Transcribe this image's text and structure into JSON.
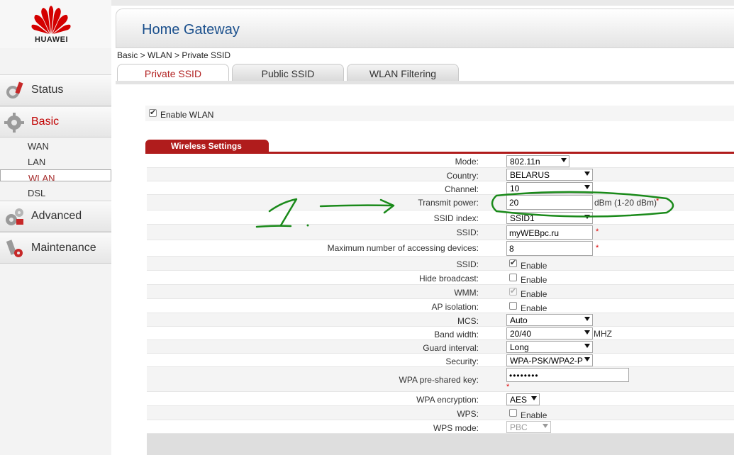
{
  "brand": {
    "name": "HUAWEI"
  },
  "header": {
    "title": "Home Gateway"
  },
  "breadcrumb": "Basic > WLAN > Private SSID",
  "sidebar": {
    "sections": [
      {
        "label": "Status",
        "icon": "status-icon"
      },
      {
        "label": "Basic",
        "icon": "gear-icon"
      },
      {
        "label": "Advanced",
        "icon": "advanced-icon"
      },
      {
        "label": "Maintenance",
        "icon": "maintenance-icon"
      }
    ],
    "basic_items": [
      "WAN",
      "LAN",
      "WLAN",
      "DSL"
    ],
    "selected_item": "WLAN"
  },
  "tabs": [
    {
      "label": "Private SSID",
      "active": true
    },
    {
      "label": "Public SSID",
      "active": false
    },
    {
      "label": "WLAN Filtering",
      "active": false
    }
  ],
  "enable_wlan": {
    "label": "Enable WLAN",
    "checked": true
  },
  "section_title": "Wireless Settings",
  "form": {
    "mode": {
      "label": "Mode:",
      "value": "802.11n"
    },
    "country": {
      "label": "Country:",
      "value": "BELARUS"
    },
    "channel": {
      "label": "Channel:",
      "value": "10"
    },
    "transmit_power": {
      "label": "Transmit power:",
      "value": "20",
      "unit": "dBm (1-20 dBm)",
      "required": "*"
    },
    "ssid_index": {
      "label": "SSID index:",
      "value": "SSID1"
    },
    "ssid_name": {
      "label": "SSID:",
      "value": "myWEBpc.ru",
      "required": "*"
    },
    "max_devices": {
      "label": "Maximum number of accessing devices:",
      "value": "8",
      "required": "*"
    },
    "ssid_enable": {
      "label": "SSID:",
      "text": "Enable",
      "checked": true
    },
    "hide_broadcast": {
      "label": "Hide broadcast:",
      "text": "Enable",
      "checked": false
    },
    "wmm": {
      "label": "WMM:",
      "text": "Enable",
      "checked": true,
      "disabled": true
    },
    "ap_isolation": {
      "label": "AP isolation:",
      "text": "Enable",
      "checked": false
    },
    "mcs": {
      "label": "MCS:",
      "value": "Auto"
    },
    "bandwidth": {
      "label": "Band width:",
      "value": "20/40",
      "unit": "MHZ"
    },
    "guard_interval": {
      "label": "Guard interval:",
      "value": "Long"
    },
    "security": {
      "label": "Security:",
      "value": "WPA-PSK/WPA2-P"
    },
    "wpa_key": {
      "label": "WPA pre-shared key:",
      "value": "••••••••",
      "required": "*"
    },
    "wpa_encryption": {
      "label": "WPA encryption:",
      "value": "AES"
    },
    "wps": {
      "label": "WPS:",
      "text": "Enable",
      "checked": false
    },
    "wps_mode": {
      "label": "WPS mode:",
      "value": "PBC"
    }
  },
  "annotation": {
    "text": "1",
    "color": "#1a8a1a"
  },
  "colors": {
    "brand_red": "#b01c1c",
    "title_blue": "#1a4f8c",
    "annotation_green": "#1a8a1a"
  }
}
